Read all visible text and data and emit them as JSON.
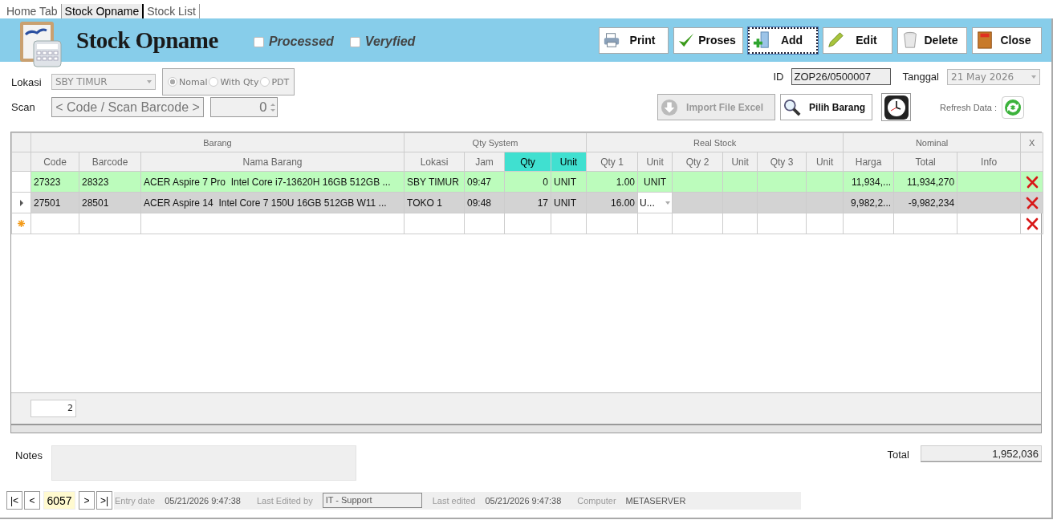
{
  "tabs": [
    {
      "label": "Home Tab",
      "selected": false
    },
    {
      "label": "Stock Opname",
      "selected": true
    },
    {
      "label": "Stock List",
      "selected": false
    }
  ],
  "header": {
    "title": "Stock Opname",
    "checks": [
      {
        "label": "Processed",
        "checked": false
      },
      {
        "label": "Veryfied",
        "checked": false
      }
    ],
    "buttons": [
      {
        "label": "Print",
        "kind": "print",
        "focused": false
      },
      {
        "label": "Proses",
        "kind": "proses",
        "focused": false
      },
      {
        "label": "Add",
        "kind": "add",
        "focused": true
      },
      {
        "label": "Edit",
        "kind": "edit",
        "focused": false
      },
      {
        "label": "Delete",
        "kind": "delete",
        "focused": false
      },
      {
        "label": "Close",
        "kind": "close",
        "focused": false
      }
    ]
  },
  "form": {
    "lokasi_label": "Lokasi",
    "lokasi_value": "SBY TIMUR",
    "modes": [
      {
        "label": "Nomal",
        "selected": true
      },
      {
        "label": "With Qty",
        "selected": false
      },
      {
        "label": "PDT",
        "selected": false
      }
    ],
    "scan_label": "Scan",
    "scan_value": "< Code / Scan Barcode >",
    "scan_qty": "0",
    "id_label": "ID",
    "id_value": "ZOP26/0500007",
    "tanggal_label": "Tanggal",
    "tanggal_value": "21 May 2026",
    "import_button": {
      "label": "Import File Excel",
      "disabled": true
    },
    "pilih_button": {
      "label": "Pilih Barang",
      "disabled": false
    },
    "refresh_label": "Refresh Data :"
  },
  "grid": {
    "groups": [
      {
        "label": "Barang"
      },
      {
        "label": "Qty System"
      },
      {
        "label": "Real Stock"
      },
      {
        "label": "Nominal"
      },
      {
        "label": "X"
      }
    ],
    "columns": [
      {
        "label": "Code",
        "highlighted": false
      },
      {
        "label": "Barcode",
        "highlighted": false
      },
      {
        "label": "Nama Barang",
        "highlighted": false
      },
      {
        "label": "Lokasi",
        "highlighted": false
      },
      {
        "label": "Jam",
        "highlighted": false
      },
      {
        "label": "Qty",
        "highlighted": true
      },
      {
        "label": "Unit",
        "highlighted": true
      },
      {
        "label": "Qty 1",
        "highlighted": false
      },
      {
        "label": "Unit",
        "highlighted": false
      },
      {
        "label": "Qty 2",
        "highlighted": false
      },
      {
        "label": "Unit",
        "highlighted": false
      },
      {
        "label": "Qty 3",
        "highlighted": false
      },
      {
        "label": "Unit",
        "highlighted": false
      },
      {
        "label": "Harga",
        "highlighted": false
      },
      {
        "label": "Total",
        "highlighted": false
      },
      {
        "label": "Info",
        "highlighted": false
      }
    ],
    "rows": [
      {
        "kind": "data",
        "selected": false,
        "color": "#bcfcbc",
        "cells": [
          "27323",
          "28323",
          "ACER Aspire 7 Pro  Intel Core i7-13620H 16GB 512GB ...",
          "SBY TIMUR",
          "09:47",
          "0",
          "UNIT",
          "1.00",
          "UNIT",
          null,
          null,
          null,
          null,
          "11,934,...",
          "11,934,270",
          null
        ]
      },
      {
        "kind": "data",
        "selected": true,
        "color": "#d3d3d3",
        "cells": [
          "27501",
          "28501",
          "ACER Aspire 14  Intel Core 7 150U 16GB 512GB W11 ...",
          "TOKO 1",
          "09:48",
          "17",
          "UNIT",
          "16.00",
          {
            "text": "U...",
            "kind": "combo"
          },
          null,
          null,
          null,
          null,
          "9,982,2...",
          "-9,982,234",
          null
        ]
      },
      {
        "kind": "new",
        "selected": false
      }
    ],
    "count": "2"
  },
  "notes_label": "Notes",
  "total_label": "Total",
  "total_value": "1,952,036",
  "status": {
    "pager": [
      "|<",
      "<",
      "6057",
      ">",
      ">|"
    ],
    "entry_label": "Entry date",
    "entry_value": "05/21/2026 9:47:38",
    "edited_by_label": "Last Edited by",
    "edited_by_value": "IT - Support",
    "edited_label": "Last edited",
    "edited_value": "05/21/2026 9:47:38",
    "computer_label": "Computer",
    "computer_value": "METASERVER"
  }
}
